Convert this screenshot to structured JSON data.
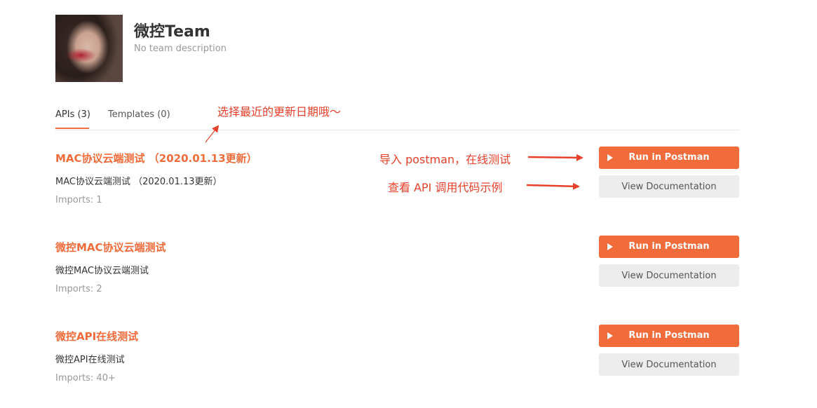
{
  "team": {
    "name": "微控Team",
    "description": "No team description"
  },
  "tabs": [
    {
      "label": "APIs (3)",
      "active": true
    },
    {
      "label": "Templates (0)",
      "active": false
    }
  ],
  "annotations": {
    "date_hint": "选择最近的更新日期哦～",
    "import_hint": "导入 postman，在线测试",
    "doc_hint": "查看 API 调用代码示例"
  },
  "colors": {
    "accent": "#f26b3a",
    "annotation": "#e8402a"
  },
  "apis": [
    {
      "title": "MAC协议云端测试 （2020.01.13更新）",
      "description": "MAC协议云端测试 （2020.01.13更新）",
      "imports": "Imports: 1",
      "run_label": "Run in Postman",
      "doc_label": "View Documentation"
    },
    {
      "title": "微控MAC协议云端测试",
      "description": "微控MAC协议云端测试",
      "imports": "Imports: 2",
      "run_label": "Run in Postman",
      "doc_label": "View Documentation"
    },
    {
      "title": "微控API在线测试",
      "description": "微控API在线测试",
      "imports": "Imports: 40+",
      "run_label": "Run in Postman",
      "doc_label": "View Documentation"
    }
  ]
}
